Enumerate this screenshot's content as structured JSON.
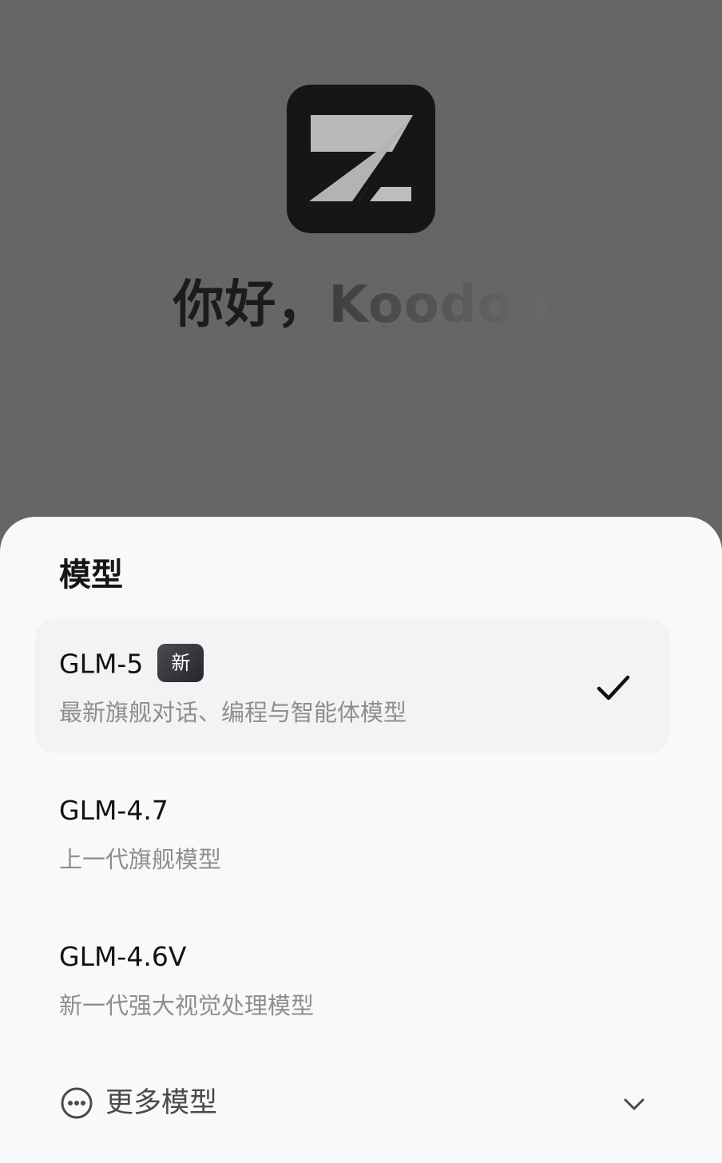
{
  "greeting": {
    "hello": "你好，",
    "name": "Koodoo"
  },
  "logo": {
    "icon": "z-logo-icon",
    "background": "#161616",
    "mark": "#b8b8b8"
  },
  "sheet": {
    "title": "模型",
    "models": [
      {
        "name": "GLM-5",
        "badge": "新",
        "description": "最新旗舰对话、编程与智能体模型",
        "selected": true
      },
      {
        "name": "GLM-4.7",
        "description": "上一代旗舰模型",
        "selected": false
      },
      {
        "name": "GLM-4.6V",
        "description": "新一代强大视觉处理模型",
        "selected": false
      }
    ],
    "more": {
      "label": "更多模型",
      "icon": "more-dots-icon",
      "expand_icon": "chevron-down-icon"
    }
  },
  "colors": {
    "backdrop": "#666666",
    "sheet": "#f8f9fa",
    "selected_row": "#f1f3f5",
    "badge": "#3a3a3f"
  }
}
